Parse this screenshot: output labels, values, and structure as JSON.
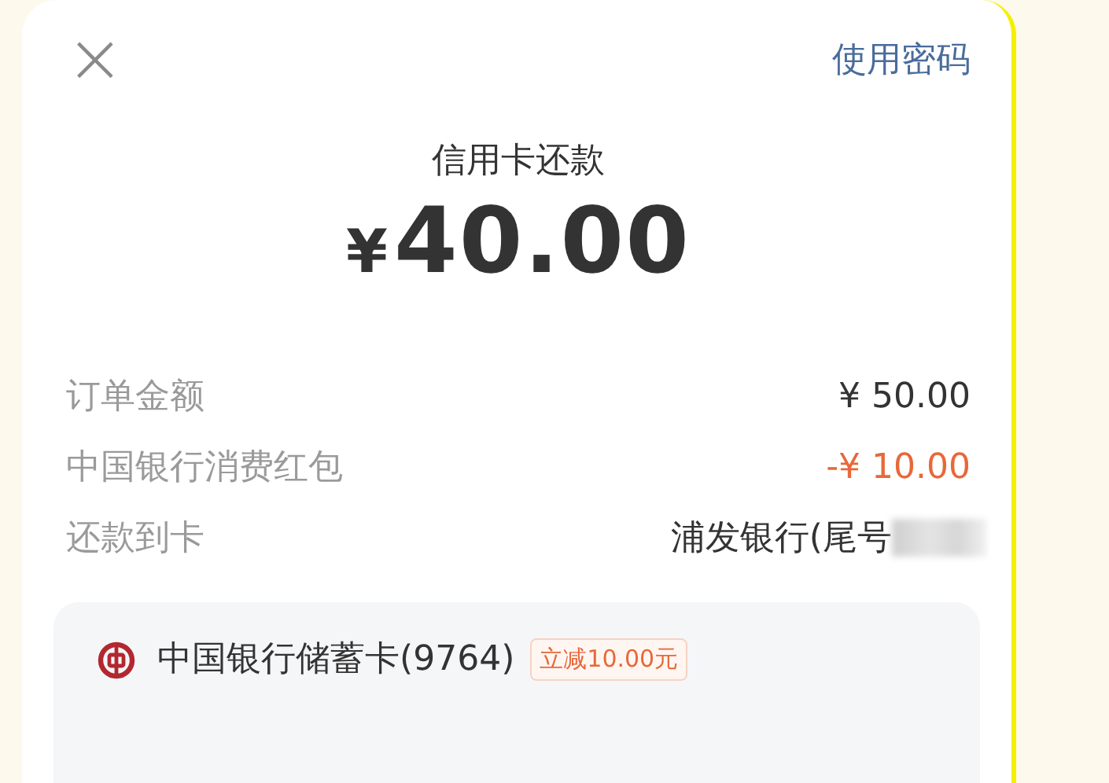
{
  "header": {
    "close": "×",
    "password_link": "使用密码"
  },
  "payment": {
    "title": "信用卡还款",
    "currency": "¥",
    "amount": "40.00"
  },
  "details": [
    {
      "label": "订单金额",
      "value": "¥ 50.00",
      "kind": "normal"
    },
    {
      "label": "中国银行消费红包",
      "value": "-¥ 10.00",
      "kind": "discount"
    },
    {
      "label": "还款到卡",
      "value": "浦发银行(尾号",
      "kind": "redacted"
    }
  ],
  "payment_method": {
    "name": "中国银行储蓄卡(9764)",
    "badge": "立减10.00元"
  }
}
